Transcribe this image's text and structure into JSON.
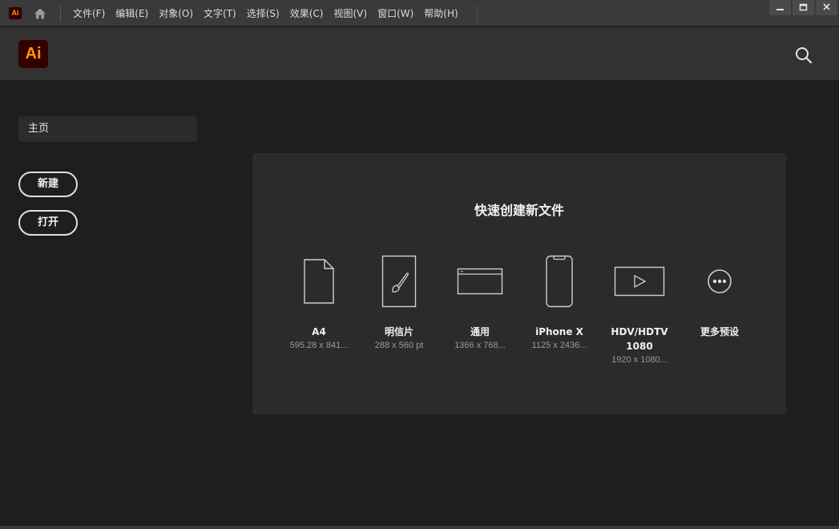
{
  "titlebar": {
    "app_badge": "Ai",
    "menus": [
      "文件(F)",
      "编辑(E)",
      "对象(O)",
      "文字(T)",
      "选择(S)",
      "效果(C)",
      "视图(V)",
      "窗口(W)",
      "帮助(H)"
    ],
    "window_controls": [
      "minimize-icon",
      "maximize-icon",
      "close-icon"
    ]
  },
  "header": {
    "logo": "Ai",
    "search_icon": "search-icon"
  },
  "sidebar": {
    "home_tab": "主页",
    "new_button": "新建",
    "open_button": "打开"
  },
  "main": {
    "title": "快速创建新文件",
    "presets": [
      {
        "name": "A4",
        "name2": "",
        "dims": "595.28 x 841...",
        "icon": "document-icon"
      },
      {
        "name": "明信片",
        "name2": "",
        "dims": "288 x 560 pt",
        "icon": "postcard-brush-icon"
      },
      {
        "name": "通用",
        "name2": "",
        "dims": "1366 x 768...",
        "icon": "browser-window-icon"
      },
      {
        "name": "iPhone X",
        "name2": "",
        "dims": "1125 x 2436...",
        "icon": "phone-icon"
      },
      {
        "name": "HDV/HDTV",
        "name2": "1080",
        "dims": "1920 x 1080...",
        "icon": "video-play-icon"
      },
      {
        "name": "更多预设",
        "name2": "",
        "dims": "",
        "icon": "more-dots-icon"
      }
    ]
  },
  "colors": {
    "background": "#1e1e1e",
    "titlebar": "#3a3a3a",
    "header": "#323232",
    "card": "#2b2b2b",
    "logo_bg": "#330000",
    "logo_fg": "#ff9a00"
  }
}
